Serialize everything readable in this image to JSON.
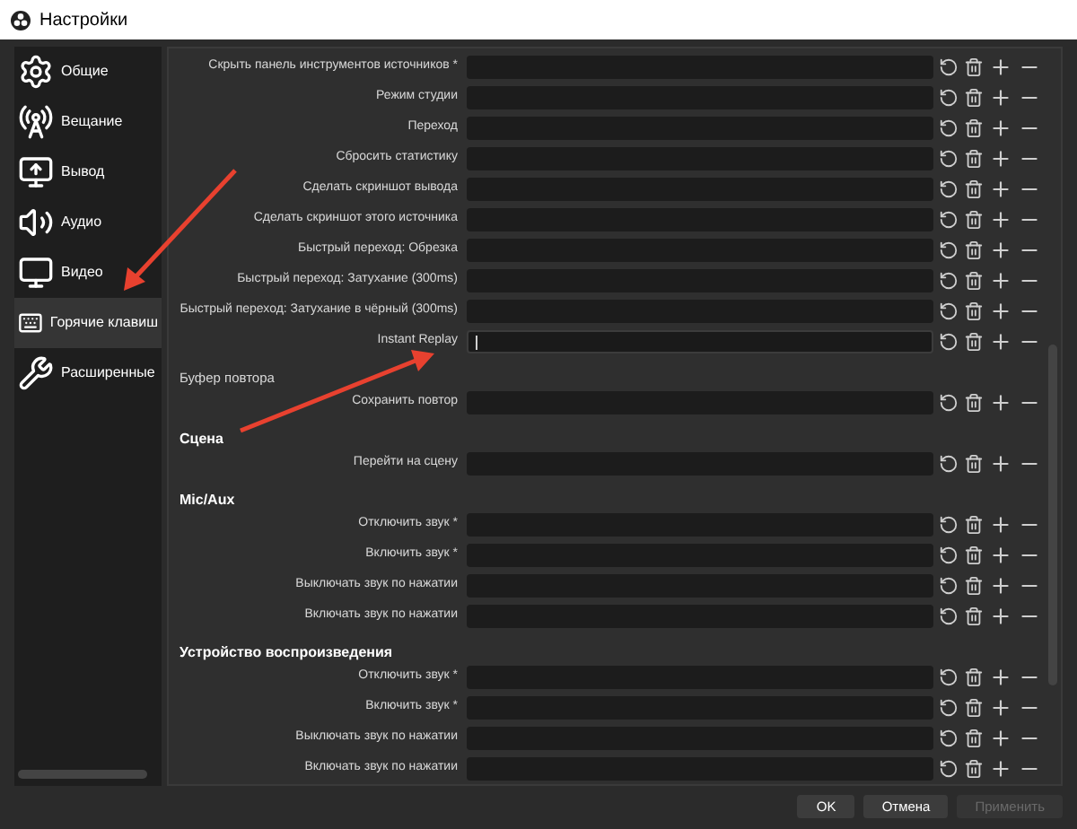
{
  "window": {
    "title": "Настройки"
  },
  "sidebar": {
    "items": [
      {
        "label": "Общие",
        "selected": false
      },
      {
        "label": "Вещание",
        "selected": false
      },
      {
        "label": "Вывод",
        "selected": false
      },
      {
        "label": "Аудио",
        "selected": false
      },
      {
        "label": "Видео",
        "selected": false
      },
      {
        "label": "Горячие клавиш",
        "selected": true
      },
      {
        "label": "Расширенные",
        "selected": false
      }
    ]
  },
  "sections": [
    {
      "kind": "none",
      "rows": [
        {
          "label": "Скрыть панель инструментов источников *",
          "focused": false
        },
        {
          "label": "Режим студии",
          "focused": false
        },
        {
          "label": "Переход",
          "focused": false
        },
        {
          "label": "Сбросить статистику",
          "focused": false
        },
        {
          "label": "Сделать скриншот вывода",
          "focused": false
        },
        {
          "label": "Сделать скриншот этого источника",
          "focused": false
        },
        {
          "label": "Быстрый переход: Обрезка",
          "focused": false
        },
        {
          "label": "Быстрый переход: Затухание (300ms)",
          "focused": false
        },
        {
          "label": "Быстрый переход: Затухание в чёрный (300ms)",
          "focused": false
        },
        {
          "label": "Instant Replay",
          "focused": true
        }
      ]
    },
    {
      "kind": "plain",
      "title": "Буфер повтора",
      "rows": [
        {
          "label": "Сохранить повтор",
          "focused": false
        }
      ]
    },
    {
      "kind": "bold",
      "title": "Сцена",
      "rows": [
        {
          "label": "Перейти на сцену",
          "focused": false
        }
      ]
    },
    {
      "kind": "bold",
      "title": "Mic/Aux",
      "rows": [
        {
          "label": "Отключить звук *",
          "focused": false
        },
        {
          "label": "Включить звук *",
          "focused": false
        },
        {
          "label": "Выключать звук по нажатии",
          "focused": false
        },
        {
          "label": "Включать звук по нажатии",
          "focused": false
        }
      ]
    },
    {
      "kind": "bold",
      "title": "Устройство воспроизведения",
      "rows": [
        {
          "label": "Отключить звук *",
          "focused": false
        },
        {
          "label": "Включить звук *",
          "focused": false
        },
        {
          "label": "Выключать звук по нажатии",
          "focused": false
        },
        {
          "label": "Включать звук по нажатии",
          "focused": false
        }
      ]
    }
  ],
  "buttons": [
    {
      "label": "OK",
      "disabled": false
    },
    {
      "label": "Отмена",
      "disabled": false
    },
    {
      "label": "Применить",
      "disabled": true
    }
  ]
}
